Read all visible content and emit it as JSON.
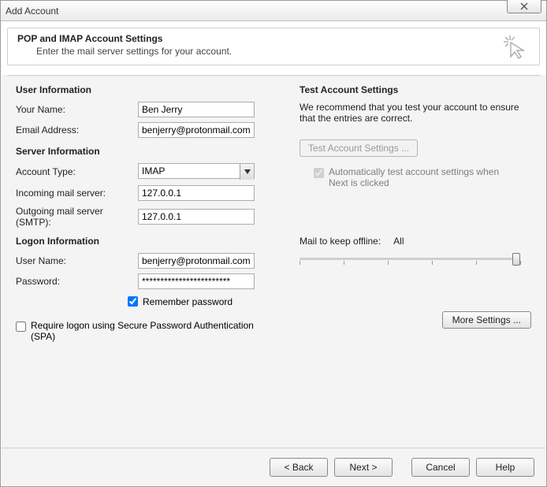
{
  "window": {
    "title": "Add Account"
  },
  "header": {
    "title": "POP and IMAP Account Settings",
    "subtitle": "Enter the mail server settings for your account."
  },
  "sections": {
    "user_info": "User Information",
    "server_info": "Server Information",
    "logon_info": "Logon Information",
    "test_settings": "Test Account Settings"
  },
  "labels": {
    "your_name": "Your Name:",
    "email": "Email Address:",
    "account_type": "Account Type:",
    "incoming": "Incoming mail server:",
    "outgoing": "Outgoing mail server (SMTP):",
    "user_name": "User Name:",
    "password": "Password:",
    "remember_pw": "Remember password",
    "require_spa": "Require logon using Secure Password Authentication (SPA)",
    "test_desc": "We recommend that you test your account to ensure that the entries are correct.",
    "test_btn": "Test Account Settings ...",
    "auto_test": "Automatically test account settings when Next is clicked",
    "mail_offline": "Mail to keep offline:",
    "mail_offline_val": "All",
    "more_settings": "More Settings ..."
  },
  "values": {
    "your_name": "Ben Jerry",
    "email": "benjerry@protonmail.com",
    "account_type": "IMAP",
    "incoming": "127.0.0.1",
    "outgoing": "127.0.0.1",
    "user_name": "benjerry@protonmail.com",
    "password": "************************"
  },
  "footer": {
    "back": "< Back",
    "next": "Next >",
    "cancel": "Cancel",
    "help": "Help"
  }
}
